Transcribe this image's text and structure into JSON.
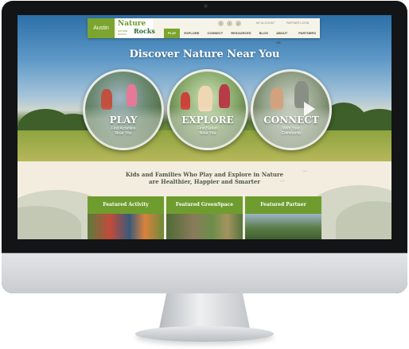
{
  "header": {
    "city": "Austin",
    "logo_line1": "Nature",
    "logo_line2": "Rocks",
    "logo_sub": "NATURE ROCKS",
    "social": [
      "f",
      "t",
      "p"
    ],
    "my_account": "MY ACCOUNT",
    "partner_login": "PARTNER LOGIN",
    "nav": [
      {
        "label": "PLAY",
        "active": true
      },
      {
        "label": "EXPLORE"
      },
      {
        "label": "CONNECT"
      },
      {
        "label": "RESOURCES"
      },
      {
        "label": "BLOG"
      },
      {
        "label": "ABOUT US"
      },
      {
        "label": "PARTNERS"
      }
    ]
  },
  "hero": {
    "title": "Discover Nature Near You",
    "circles": [
      {
        "label": "PLAY",
        "sub1": "Find Activities",
        "sub2": "Near You"
      },
      {
        "label": "EXPLORE",
        "sub1": "Find Nature",
        "sub2": "Near You"
      },
      {
        "label": "CONNECT",
        "sub1": "With Your",
        "sub2": "Community"
      }
    ]
  },
  "tagline": {
    "line1": "Kids and Families Who Play and Explore in Nature",
    "line2": "are Healthier, Happier and Smarter"
  },
  "cards": [
    {
      "title": "Featured Activity"
    },
    {
      "title": "Featured GreenSpace"
    },
    {
      "title": "Featured Partner"
    }
  ],
  "colors": {
    "accent": "#7ba52e",
    "card": "#6f9c2f"
  }
}
